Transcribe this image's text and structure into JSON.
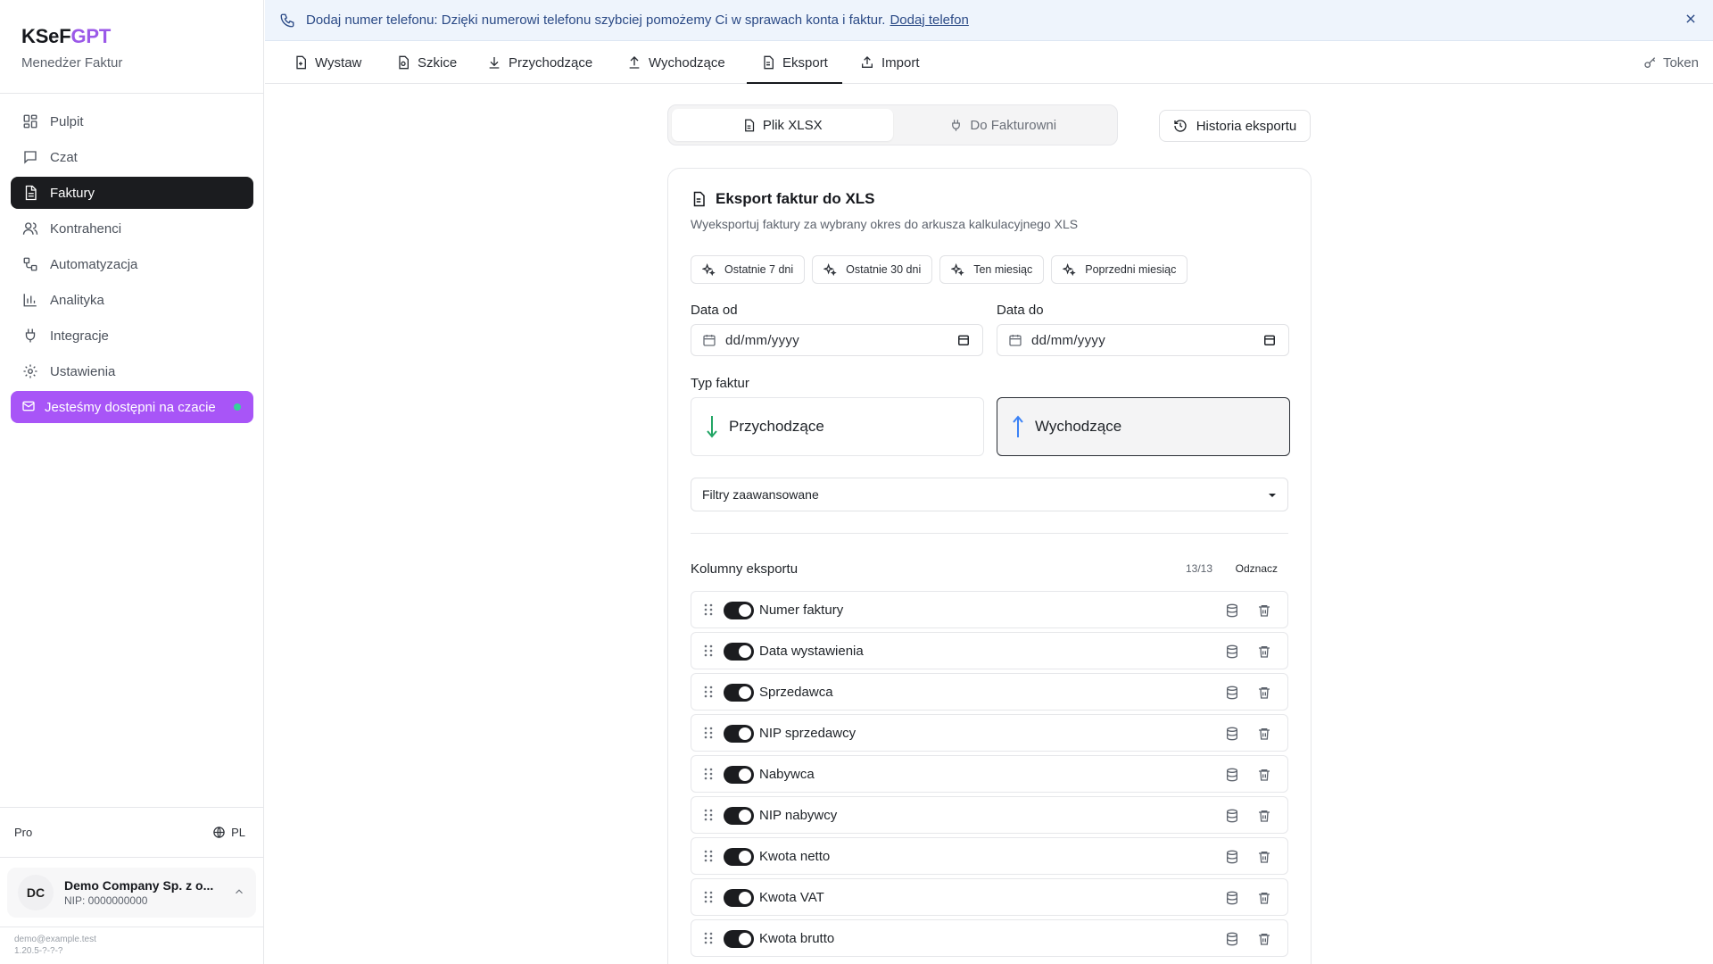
{
  "brand": {
    "title_a": "KSeF",
    "title_b": "GPT",
    "subtitle": "Menedżer Faktur"
  },
  "sidebar": {
    "items": [
      {
        "label": "Pulpit",
        "icon": "dashboard-icon"
      },
      {
        "label": "Czat",
        "icon": "chat-icon"
      },
      {
        "label": "Faktury",
        "icon": "invoice-icon",
        "active": true
      },
      {
        "label": "Kontrahenci",
        "icon": "users-icon"
      },
      {
        "label": "Automatyzacja",
        "icon": "workflow-icon"
      },
      {
        "label": "Analityka",
        "icon": "chart-icon"
      },
      {
        "label": "Integracje",
        "icon": "plug-icon"
      },
      {
        "label": "Ustawienia",
        "icon": "gear-icon"
      }
    ],
    "chat_cta": "Jesteśmy dostępni na czacie",
    "plan": "Pro",
    "language": "PL",
    "company": {
      "initials": "DC",
      "name": "Demo Company Sp. z o...",
      "nip": "NIP: 0000000000"
    },
    "footer_email": "demo@example.test",
    "footer_version": "1.20.5-?-?-?"
  },
  "banner": {
    "text": "Dodaj numer telefonu: Dzięki numerowi telefonu szybciej pomożemy Ci w sprawach konta i faktur.",
    "link": "Dodaj telefon"
  },
  "tabs": [
    {
      "label": "Wystaw",
      "icon": "file-plus-icon"
    },
    {
      "label": "Szkice",
      "icon": "draft-icon"
    },
    {
      "label": "Przychodzące",
      "icon": "download-icon"
    },
    {
      "label": "Wychodzące",
      "icon": "upload-icon"
    },
    {
      "label": "Eksport",
      "icon": "file-text-icon",
      "active": true
    },
    {
      "label": "Import",
      "icon": "import-icon"
    }
  ],
  "token_label": "Token",
  "export_modes": [
    {
      "label": "Plik XLSX",
      "active": true
    },
    {
      "label": "Do Fakturowni",
      "active": false
    }
  ],
  "history_label": "Historia eksportu",
  "card": {
    "title": "Eksport faktur do XLS",
    "description": "Wyeksportuj faktury za wybrany okres do arkusza kalkulacyjnego XLS",
    "quick_ranges": [
      "Ostatnie 7 dni",
      "Ostatnie 30 dni",
      "Ten miesiąc",
      "Poprzedni miesiąc"
    ],
    "date_from_label": "Data od",
    "date_to_label": "Data do",
    "date_placeholder": "dd/mm/yyyy",
    "type_label": "Typ faktur",
    "types": [
      {
        "label": "Przychodzące",
        "selected": false,
        "color": "#22a565"
      },
      {
        "label": "Wychodzące",
        "selected": true,
        "color": "#3b82f6"
      }
    ],
    "filters_label": "Filtry zaawansowane",
    "columns_label": "Kolumny eksportu",
    "columns_count": "13/13",
    "columns_toggle": "Odznacz",
    "columns": [
      "Numer faktury",
      "Data wystawienia",
      "Sprzedawca",
      "NIP sprzedawcy",
      "Nabywca",
      "NIP nabywcy",
      "Kwota netto",
      "Kwota VAT",
      "Kwota brutto"
    ]
  }
}
